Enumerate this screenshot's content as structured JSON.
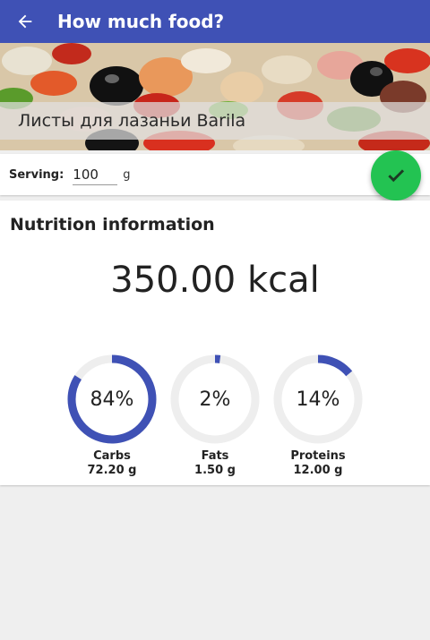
{
  "appbar": {
    "title": "How much food?",
    "back_icon": "arrow-back-icon"
  },
  "hero": {
    "product_name": "Листы для лазаньи Barila"
  },
  "serving": {
    "label": "Serving:",
    "value": "100",
    "unit": "g"
  },
  "fab": {
    "icon": "check-icon"
  },
  "nutrition": {
    "title": "Nutrition information",
    "kcal": "350.00 kcal",
    "macros": [
      {
        "name": "Carbs",
        "percent_label": "84%",
        "percent": 84,
        "amount": "72.20 g"
      },
      {
        "name": "Fats",
        "percent_label": "2%",
        "percent": 2,
        "amount": "1.50 g"
      },
      {
        "name": "Proteins",
        "percent_label": "14%",
        "percent": 14,
        "amount": "12.00 g"
      }
    ]
  },
  "colors": {
    "primary": "#3f51b5",
    "accent": "#23c352",
    "ring_track": "#eeeeee",
    "ring_fill": "#3f51b5"
  }
}
